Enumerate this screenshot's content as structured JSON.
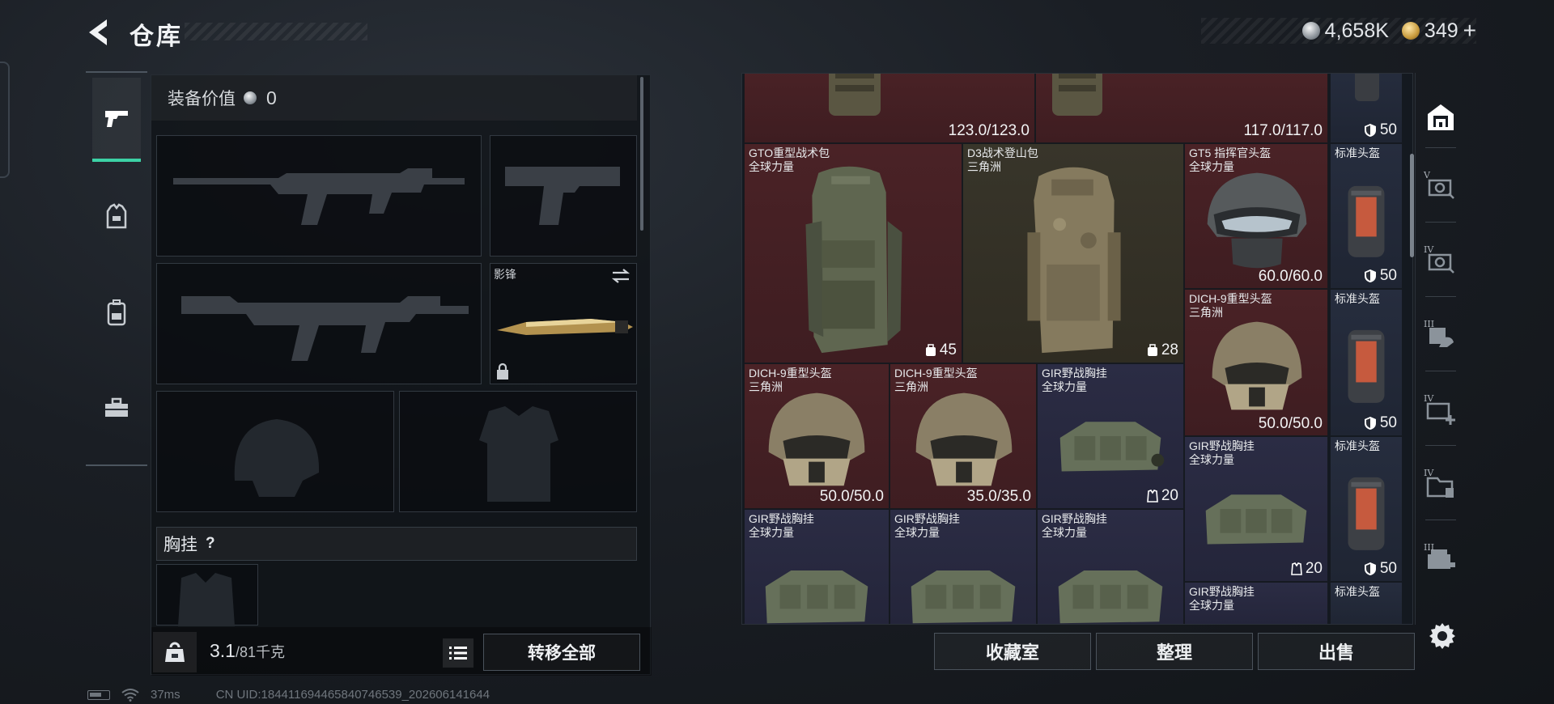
{
  "header": {
    "title": "仓库",
    "silver": "4,658K",
    "gold": "349",
    "gold_plus": "+"
  },
  "loadout": {
    "gear_value_label": "装备价值",
    "gear_value": "0",
    "melee_name": "影锋",
    "chest_rig_label": "胸挂",
    "help": "?",
    "weight_current": "3.1",
    "weight_max": "/81千克",
    "transfer_all": "转移全部"
  },
  "inventory": {
    "items": [
      {
        "dur": "123.0/123.0"
      },
      {
        "dur": "117.0/117.0"
      },
      {
        "tag": "50"
      },
      {
        "name1": "GTO重型战术包",
        "name2": "全球力量",
        "tag": "45"
      },
      {
        "name1": "D3战术登山包",
        "name2": "三角洲",
        "tag": "28"
      },
      {
        "name1": "GT5 指挥官头盔",
        "name2": "全球力量",
        "dur": "60.0/60.0"
      },
      {
        "name1": "标准头盔",
        "tag": "50"
      },
      {
        "name1": "DICH-9重型头盔",
        "name2": "三角洲",
        "dur": "50.0/50.0"
      },
      {
        "name1": "标准头盔",
        "tag": "50"
      },
      {
        "name1": "DICH-9重型头盔",
        "name2": "三角洲",
        "dur": "50.0/50.0"
      },
      {
        "name1": "DICH-9重型头盔",
        "name2": "三角洲",
        "dur": "35.0/35.0"
      },
      {
        "name1": "GIR野战胸挂",
        "name2": "全球力量",
        "tag": "20"
      },
      {
        "name1": "GIR野战胸挂",
        "name2": "全球力量",
        "tag": "20"
      },
      {
        "name1": "标准头盔",
        "tag": "50"
      },
      {
        "name1": "GIR野战胸挂",
        "name2": "全球力量"
      },
      {
        "name1": "GIR野战胸挂",
        "name2": "全球力量"
      },
      {
        "name1": "GIR野战胸挂",
        "name2": "全球力量"
      },
      {
        "name1": "GIR野战胸挂",
        "name2": "全球力量"
      },
      {
        "name1": "标准头盔"
      }
    ]
  },
  "filters": {
    "roman": [
      "V",
      "IV",
      "III",
      "IV",
      "IV",
      "III"
    ]
  },
  "actions": {
    "collection": "收藏室",
    "organize": "整理",
    "sell": "出售"
  },
  "status": {
    "ping": "37ms",
    "uid": "CN UID:18441169446584074653​9_202606141644"
  },
  "colors": {
    "accent": "#3cd2a6",
    "rarity_red": "#4a2226",
    "rarity_purple": "#2b2c44",
    "rarity_gold": "#38352a",
    "rarity_blue": "#262d3e"
  }
}
